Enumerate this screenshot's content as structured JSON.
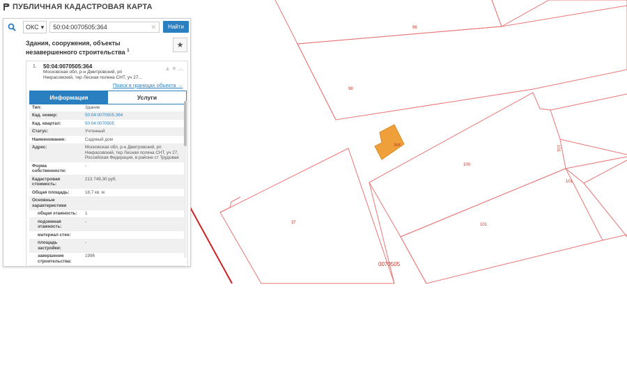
{
  "app": {
    "title": "ПУБЛИЧНАЯ КАДАСТРОВАЯ КАРТА"
  },
  "search": {
    "type": "ОКС",
    "query": "50:04:0070505:364",
    "button": "Найти"
  },
  "result": {
    "section_title": "Здания, сооружения, объекты незавершенного строительства",
    "section_count": "1",
    "index": "1.",
    "cad_number": "50:04:0070505:364",
    "address": "Московская обл, р-н Дмитровский, рп Некрасовский, тер Лесная поляна СНТ, уч 27...",
    "search_within": "Поиск в границах объекта →",
    "tabs": [
      "Информация",
      "Услуги"
    ],
    "properties": [
      {
        "label": "Тип:",
        "value": "Здание"
      },
      {
        "label": "Кад. номер:",
        "value": "50:04:0070505:364",
        "link": true
      },
      {
        "label": "Кад. квартал:",
        "value": "50:04:0070505",
        "link": true
      },
      {
        "label": "Статус:",
        "value": "Учтенный"
      },
      {
        "label": "Наименование:",
        "value": "Садовый дом"
      },
      {
        "label": "Адрес:",
        "value": "Московская обл, р-н Дмитровский, рп Некрасовский, тер Лесная поляна СНТ, уч 27, Российская Федерация, в районе ст Трудовая"
      },
      {
        "label": "Форма собственности:",
        "value": "-"
      },
      {
        "label": "Кадастровая стоимость:",
        "value": "213 749,30 руб."
      },
      {
        "label": "Общая площадь:",
        "value": "18,7 кв. м"
      },
      {
        "label": "Основные характеристики",
        "value": ""
      },
      {
        "label": "общая этажность:",
        "value": "1",
        "sub": true
      },
      {
        "label": "подземная этажность:",
        "value": "-",
        "sub": true
      },
      {
        "label": "материал стен:",
        "value": "",
        "sub": true
      },
      {
        "label": "площадь застройки:",
        "value": "-",
        "sub": true
      },
      {
        "label": "завершение строительства:",
        "value": "1996",
        "sub": true
      }
    ]
  },
  "map": {
    "parcel_labels": [
      "96",
      "98",
      "100",
      "101",
      "101",
      "101",
      "37"
    ],
    "quarter_label": "0070505",
    "building_label": "364",
    "colors": {
      "parcel_line": "#e87575",
      "quarter_line": "#cc2222",
      "building_fill": "#f0a03a",
      "label": "#c0392b"
    }
  }
}
